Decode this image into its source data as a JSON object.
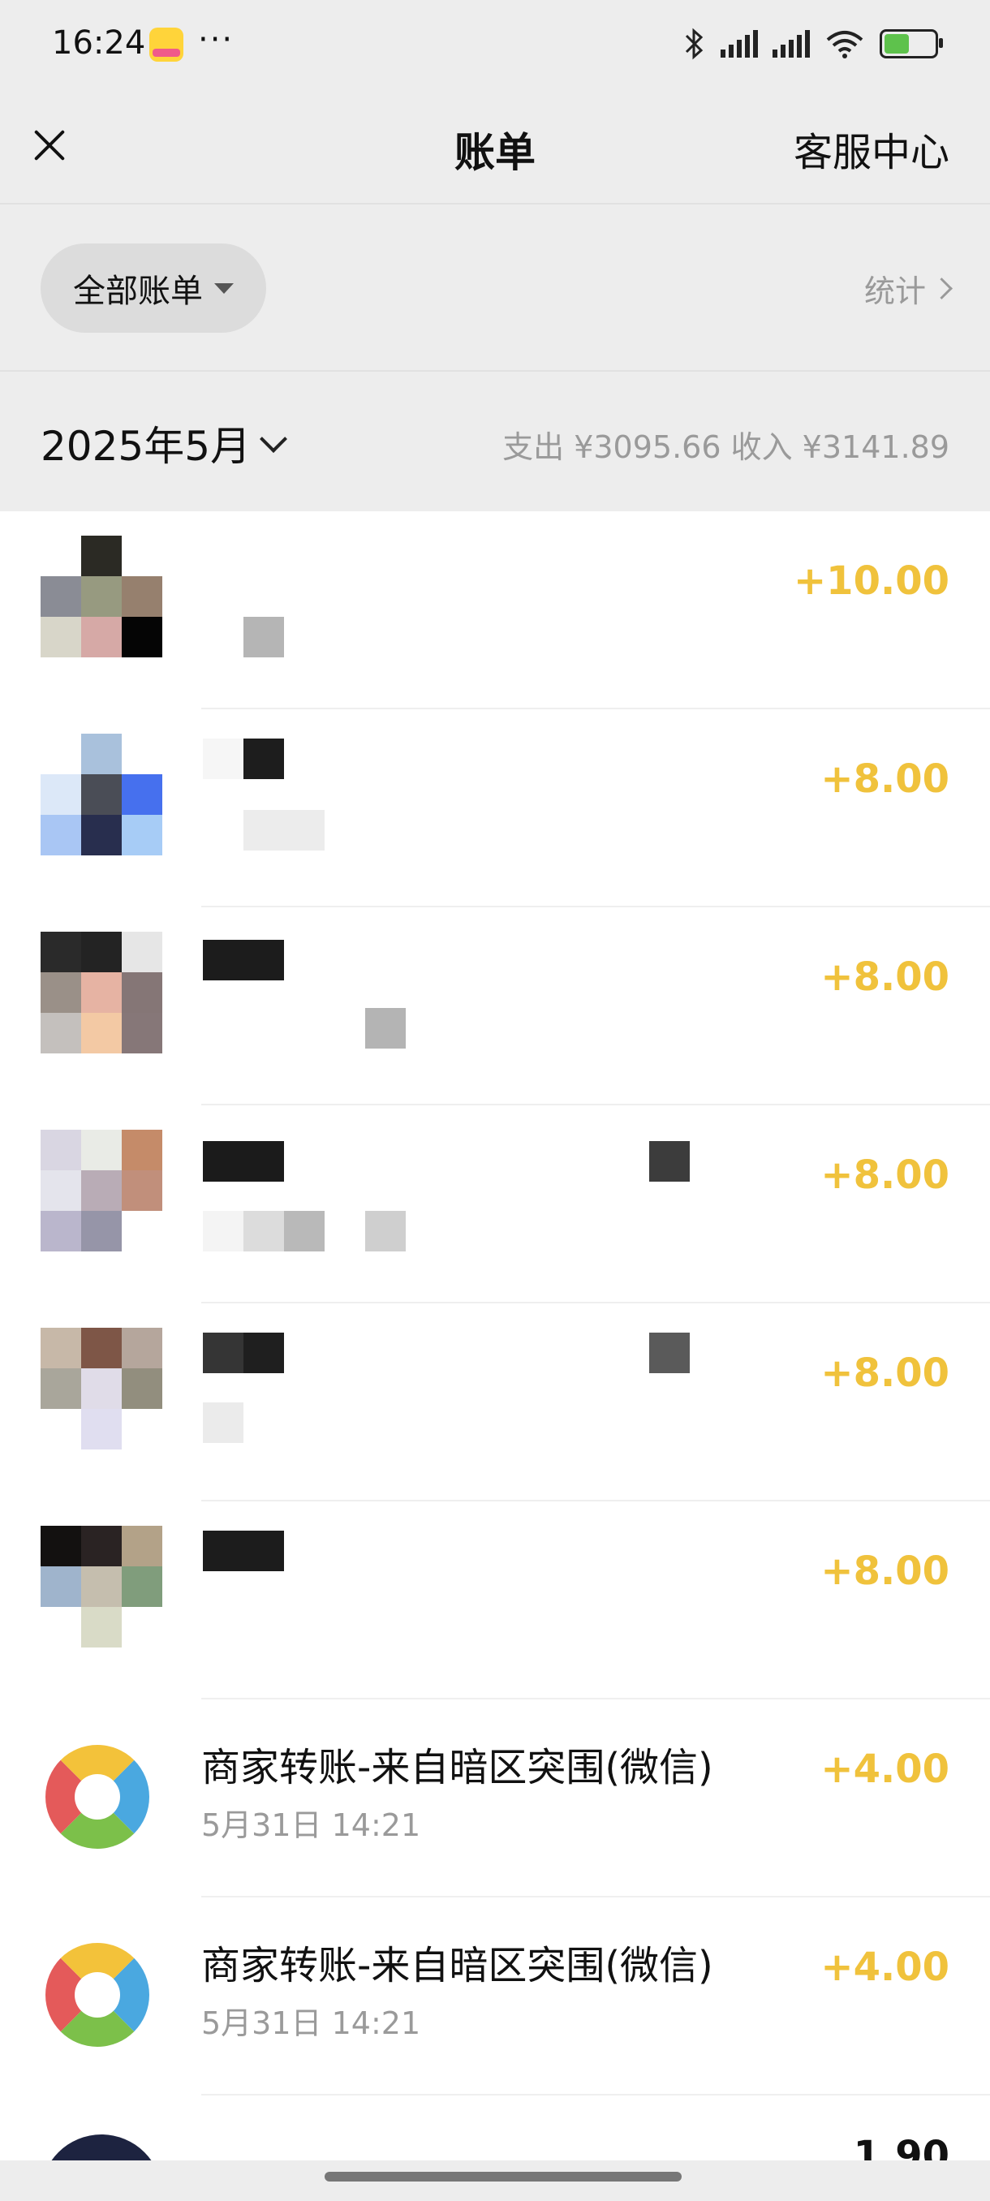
{
  "status_bar": {
    "time": "16:24",
    "dots": "···",
    "app_icon": "meituan-app-icon"
  },
  "nav": {
    "title": "账单",
    "service": "客服中心"
  },
  "filter": {
    "label": "全部账单",
    "stats": "统计"
  },
  "month": {
    "label": "2025年5月",
    "summary": "支出 ¥3095.66  收入 ¥3141.89"
  },
  "items": [
    {
      "amount": "+10.00",
      "title": "",
      "time": ""
    },
    {
      "amount": "+8.00",
      "title": "",
      "time": ""
    },
    {
      "amount": "+8.00",
      "title": "",
      "time": ""
    },
    {
      "amount": "+8.00",
      "title": "",
      "time": ""
    },
    {
      "amount": "+8.00",
      "title": "",
      "time": ""
    },
    {
      "amount": "+8.00",
      "title": "",
      "time": ""
    },
    {
      "amount": "+4.00",
      "title": "商家转账-来自暗区突围(微信)",
      "time": "5月31日 14:21"
    },
    {
      "amount": "+4.00",
      "title": "商家转账-来自暗区突围(微信)",
      "time": "5月31日 14:21"
    }
  ],
  "partial_amount": "1.90",
  "colors": {
    "income": "#f0c23c",
    "muted": "#9a9a9a",
    "bg": "#ededed"
  }
}
